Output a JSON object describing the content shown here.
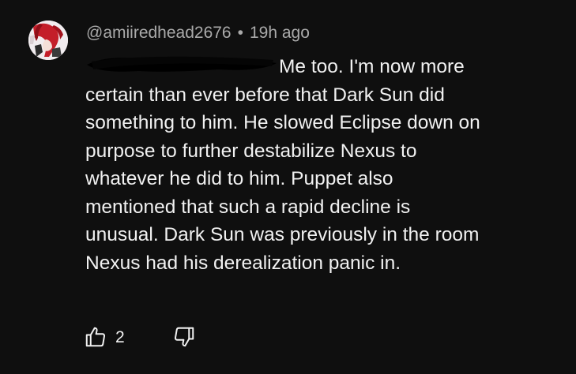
{
  "comment": {
    "author": "@amiiredhead2676",
    "separator": "•",
    "time": "19h ago",
    "text": "Me too. I'm now more certain than ever before that Dark Sun did something to him. He slowed Eclipse down on purpose to further destabilize Nexus to whatever he did to him. Puppet also mentioned that such a rapid decline is unusual. Dark Sun was previously in the room Nexus had his derealization panic in.",
    "lines": [
      "Me too. I'm now more",
      "certain than ever before that Dark Sun did",
      "something to him. He slowed Eclipse down on",
      "purpose to further destabilize Nexus to",
      "whatever he did to him. Puppet also",
      "mentioned that such a rapid decline is",
      "unusual. Dark Sun was previously in the room",
      "Nexus had his derealization panic in."
    ],
    "like_count": "2"
  },
  "icons": {
    "like": "thumbs-up-icon",
    "dislike": "thumbs-down-icon"
  },
  "colors": {
    "background": "#0f0f0f",
    "text": "#f1f1f1",
    "meta": "#aaaaaa",
    "redaction": "#000000"
  }
}
